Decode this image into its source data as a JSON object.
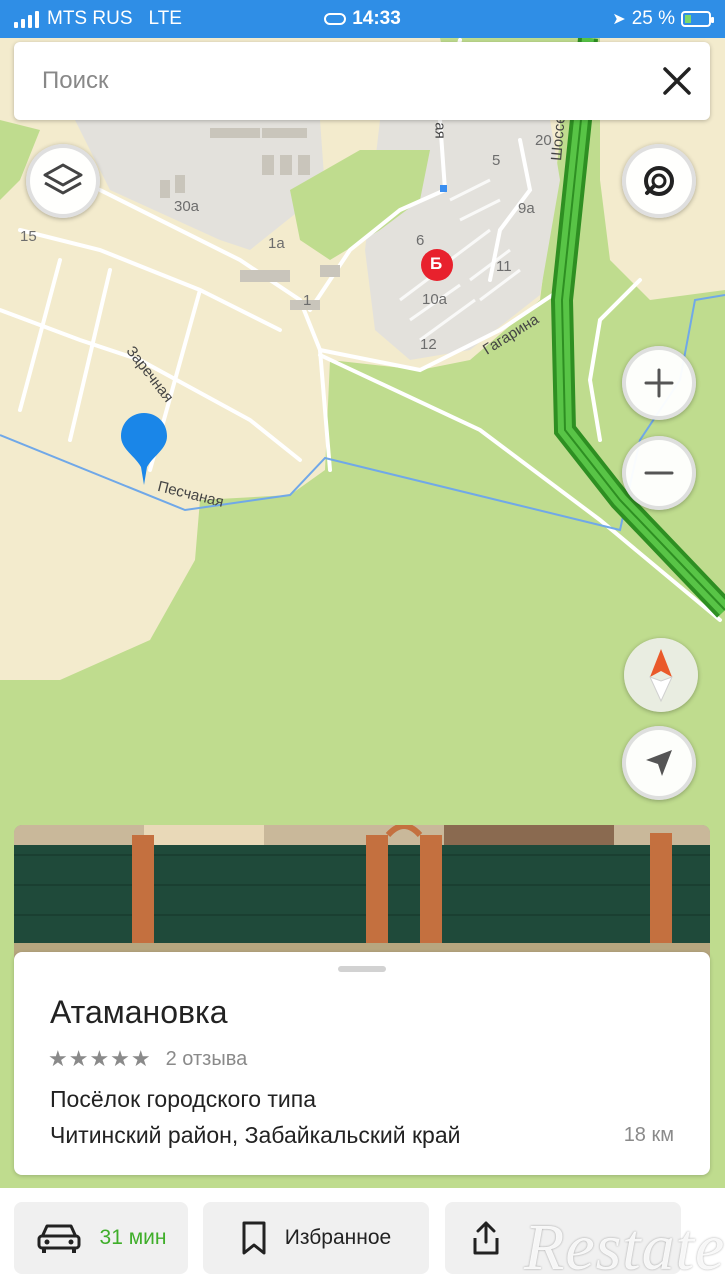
{
  "status_bar": {
    "carrier": "MTS RUS",
    "network": "LTE",
    "time": "14:33",
    "battery": "25 %"
  },
  "search": {
    "placeholder": "Поиск"
  },
  "map": {
    "labels": {
      "house_30a": "30а",
      "house_15": "15",
      "house_1a": "1а",
      "house_1": "1",
      "house_20": "20",
      "house_5": "5",
      "house_9a": "9а",
      "house_6": "6",
      "house_11": "11",
      "house_10a": "10а",
      "house_12": "12",
      "street_partial": "ая",
      "street_zarechnaya": "Заречная",
      "street_peschanaya": "Песчаная",
      "street_gagarina": "Гагарина",
      "street_shosseynaya": "Шоссейн",
      "bus_stop": "Б"
    }
  },
  "place_card": {
    "title": "Атамановка",
    "stars": "★★★★★",
    "reviews": "2 отзыва",
    "type": "Посёлок городского типа",
    "region": "Читинский район, Забайкальский край",
    "distance": "18 км"
  },
  "bottom_bar": {
    "route_time": "31 мин",
    "favorites": "Избранное"
  },
  "watermark": "Restate",
  "colors": {
    "status_bar": "#2f8ee6",
    "map_green": "#bfdc8e",
    "map_settlement": "#f3ebcd",
    "highway": "#3fae2a",
    "pin": "#1a86e8",
    "bus_stop": "#e8212d",
    "route_text": "#3fae2a"
  }
}
